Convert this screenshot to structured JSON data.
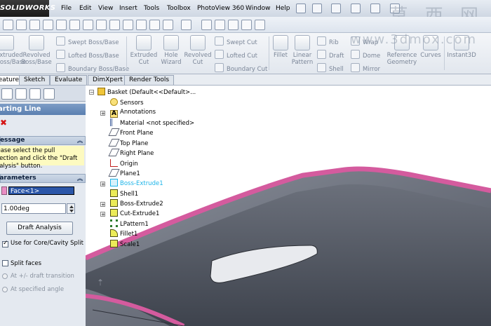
{
  "app": {
    "logo": "SOLIDWORKS"
  },
  "menu": [
    "File",
    "Edit",
    "View",
    "Insert",
    "Tools",
    "Toolbox",
    "PhotoView 360",
    "Window",
    "Help"
  ],
  "watermark": {
    "chars": "莫 西 网",
    "site": "www.3dmox.com"
  },
  "ribbon": {
    "extruded_boss": "Extruded\nBoss/Base",
    "revolved_boss": "Revolved\nBoss/Base",
    "swept_boss": "Swept Boss/Base",
    "lofted_boss": "Lofted Boss/Base",
    "boundary_boss": "Boundary Boss/Base",
    "extruded_cut": "Extruded\nCut",
    "hole_wizard": "Hole\nWizard",
    "revolved_cut": "Revolved\nCut",
    "swept_cut": "Swept Cut",
    "lofted_cut": "Lofted Cut",
    "boundary_cut": "Boundary Cut",
    "fillet": "Fillet",
    "linear_pattern": "Linear\nPattern",
    "rib": "Rib",
    "draft": "Draft",
    "shell": "Shell",
    "wrap": "Wrap",
    "dome": "Dome",
    "mirror": "Mirror",
    "reference_geometry": "Reference\nGeometry",
    "curves": "Curves",
    "instant3d": "Instant3D"
  },
  "tabs": [
    "Features",
    "Sketch",
    "Evaluate",
    "DimXpert",
    "Render Tools"
  ],
  "active_tab": "Features",
  "propertymanager": {
    "title": "Parting Line",
    "message_header": "Message",
    "message": "Please select the pull direction and click the \"Draft Analysis\" button.",
    "params_header": "Parameters",
    "face_value": "Face<1>",
    "angle_value": "1.00deg",
    "draft_button": "Draft Analysis",
    "core_cavity_label": "Use for Core/Cavity Split",
    "core_cavity_checked": true,
    "split_faces_label": "Split faces",
    "split_faces_checked": false,
    "radio_transition": "At +/- draft transition",
    "radio_angle": "At specified angle"
  },
  "tree": {
    "root": "Basket  (Default<<Default>...",
    "items": [
      {
        "label": "Sensors"
      },
      {
        "label": "Annotations"
      },
      {
        "label": "Material <not specified>"
      },
      {
        "label": "Front Plane"
      },
      {
        "label": "Top Plane"
      },
      {
        "label": "Right Plane"
      },
      {
        "label": "Origin"
      },
      {
        "label": "Plane1"
      },
      {
        "label": "Boss-Extrude1"
      },
      {
        "label": "Shell1"
      },
      {
        "label": "Boss-Extrude2"
      },
      {
        "label": "Cut-Extrude1"
      },
      {
        "label": "LPattern1"
      },
      {
        "label": "Fillet1"
      },
      {
        "label": "Scale1"
      }
    ]
  },
  "colors": {
    "model_gray": "#5f6470",
    "model_edge_pink": "#d45b9e",
    "selected_text": "#1db4e8"
  }
}
